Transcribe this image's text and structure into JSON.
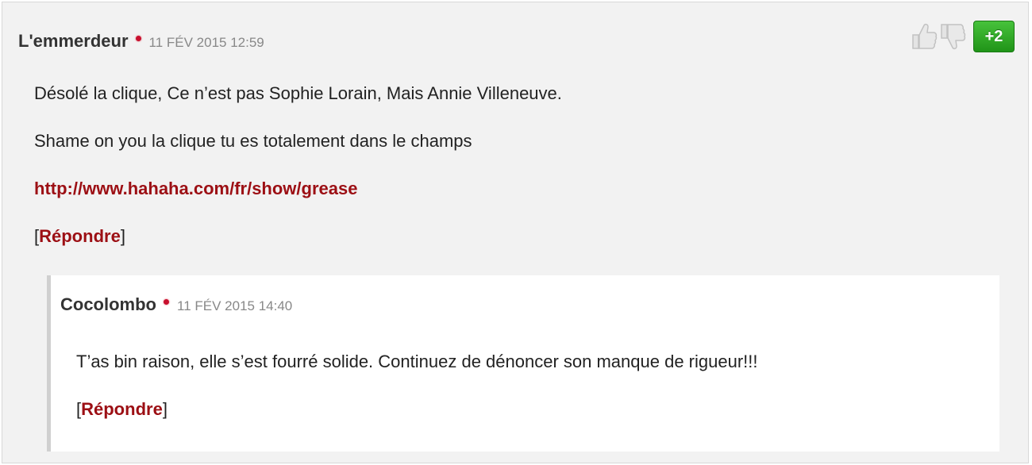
{
  "comment": {
    "author": "L'emmerdeur",
    "timestamp": "11 FÉV 2015 12:59",
    "score": "+2",
    "paragraphs": [
      "Désolé la clique, Ce n’est pas Sophie Lorain, Mais Annie Villeneuve.",
      "Shame on you la clique tu es totalement dans le champs"
    ],
    "link": "http://www.hahaha.com/fr/show/grease",
    "reply_open": "[",
    "reply_label": "Répondre",
    "reply_close": "]",
    "icons": {
      "upvote": "thumbs-up-icon",
      "downvote": "thumbs-down-icon"
    }
  },
  "reply": {
    "author": "Cocolombo",
    "timestamp": "11 FÉV 2015 14:40",
    "paragraphs": [
      "T’as bin raison, elle s’est fourré solide. Continuez de dénoncer son manque de rigueur!!!"
    ],
    "reply_open": "[",
    "reply_label": "Répondre",
    "reply_close": "]"
  },
  "colors": {
    "accent": "#9c0f14",
    "score_bg": "#2fa825",
    "status_dot": "#c8102e"
  }
}
